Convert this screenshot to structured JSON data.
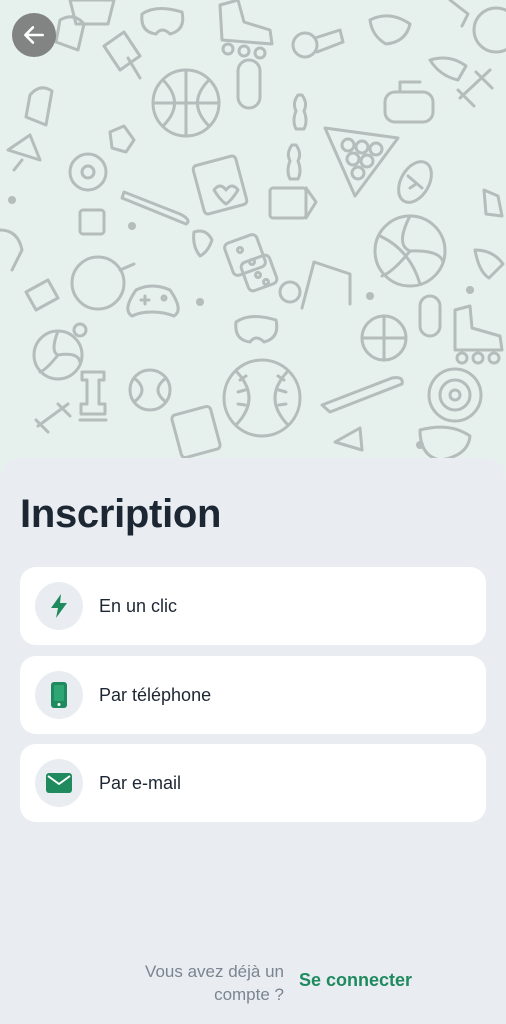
{
  "colors": {
    "accent": "#1e8a5e",
    "hero_bg": "#e6f0ec",
    "sheet_bg": "#e9edf2",
    "card_bg": "#ffffff",
    "pattern": "#b5bcbc"
  },
  "header": {
    "back_icon": "arrow-left-icon"
  },
  "hero": {
    "pattern_icons": [
      "basketball-icon",
      "volleyball-icon",
      "baseball-icon",
      "billiards-icon",
      "dice-icon",
      "rollerskate-icon",
      "bowling-icon",
      "chess-icon",
      "ping-pong-icon",
      "gamepad-icon",
      "shuttlecock-icon",
      "target-icon",
      "whistle-icon",
      "cards-icon",
      "dumbbell-icon",
      "skateboard-icon"
    ]
  },
  "signup": {
    "title": "Inscription",
    "options": [
      {
        "label": "En un clic",
        "icon": "lightning-icon"
      },
      {
        "label": "Par téléphone",
        "icon": "phone-icon"
      },
      {
        "label": "Par e-mail",
        "icon": "envelope-icon"
      }
    ]
  },
  "footer": {
    "question": "Vous avez déjà un compte ?",
    "login_link": "Se connecter"
  }
}
